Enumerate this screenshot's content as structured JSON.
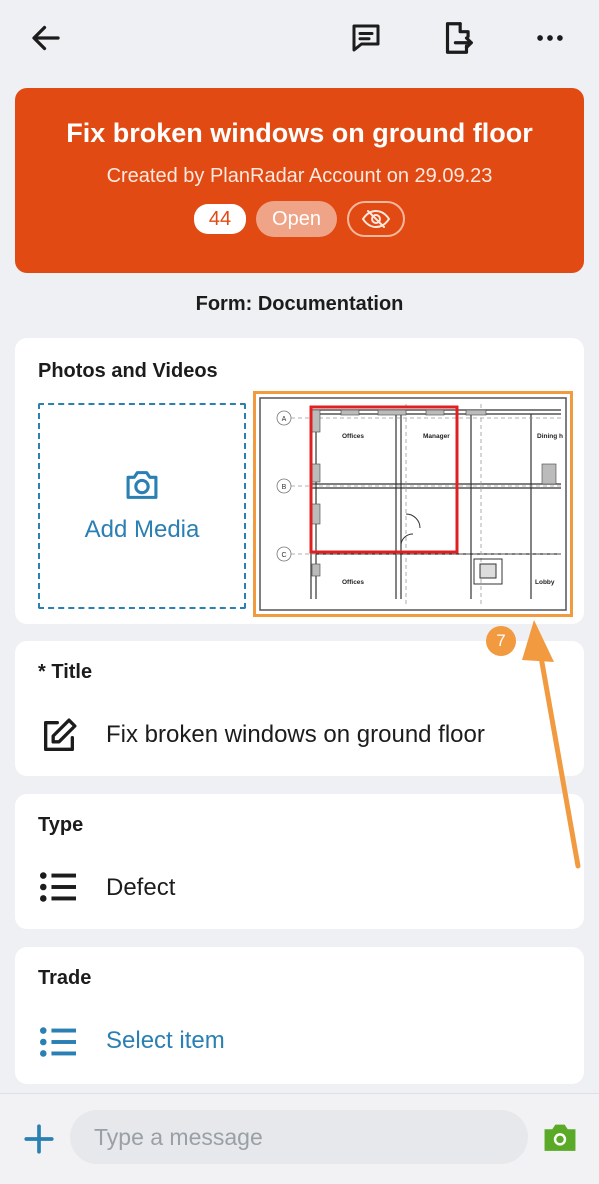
{
  "header": {
    "title": "Fix broken windows on ground floor",
    "subtitle": "Created by PlanRadar Account on 29.09.23",
    "ticket_number": "44",
    "status": "Open",
    "accent_color": "#e24a13"
  },
  "form_label": "Form: Documentation",
  "media": {
    "section_title": "Photos and Videos",
    "add_label": "Add Media",
    "plan_rooms": [
      "Offices",
      "Manager",
      "Dining h",
      "Offices",
      "Lobby"
    ],
    "plan_row_labels": [
      "A",
      "B",
      "C"
    ]
  },
  "title_field": {
    "label": "* Title",
    "value": "Fix broken windows on ground floor"
  },
  "type_field": {
    "label": "Type",
    "value": "Defect"
  },
  "trade_field": {
    "label": "Trade",
    "value": "Select item"
  },
  "annotation": {
    "number": "7",
    "color": "#f29a3f"
  },
  "message": {
    "placeholder": "Type a message"
  },
  "icons": {
    "back": "arrow-left-icon",
    "comment": "comment-icon",
    "export": "export-icon",
    "more": "more-dots-icon",
    "hidden": "eye-off-icon",
    "camera": "camera-icon",
    "edit": "edit-icon",
    "list": "list-icon",
    "add": "plus-icon"
  }
}
